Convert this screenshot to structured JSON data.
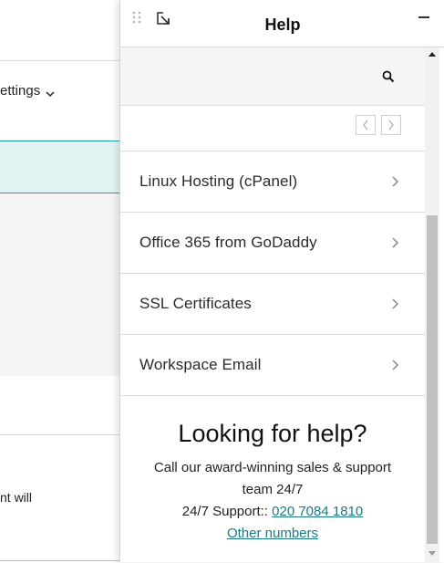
{
  "background": {
    "settings_label": "ettings",
    "partial_text": "nt will"
  },
  "help": {
    "title": "Help",
    "topics": [
      {
        "label": "Linux Hosting (cPanel)"
      },
      {
        "label": "Office 365 from GoDaddy"
      },
      {
        "label": "SSL Certificates"
      },
      {
        "label": "Workspace Email"
      }
    ],
    "footer": {
      "heading": "Looking for help?",
      "line1": "Call our award-winning sales & support",
      "line2": "team 24/7",
      "support_label": "24/7 Support:: ",
      "phone": "020 7084 1810",
      "other_numbers": "Other numbers"
    }
  },
  "icons": {
    "drag": "drag-handle-icon",
    "popout": "popout-icon",
    "minimize": "minimize-icon",
    "search": "search-icon",
    "prev": "chevron-left-icon",
    "next": "chevron-right-icon"
  },
  "colors": {
    "accent_teal": "#1ba39c",
    "teal_fill": "#e2f4f3",
    "link": "#1a7a87"
  }
}
